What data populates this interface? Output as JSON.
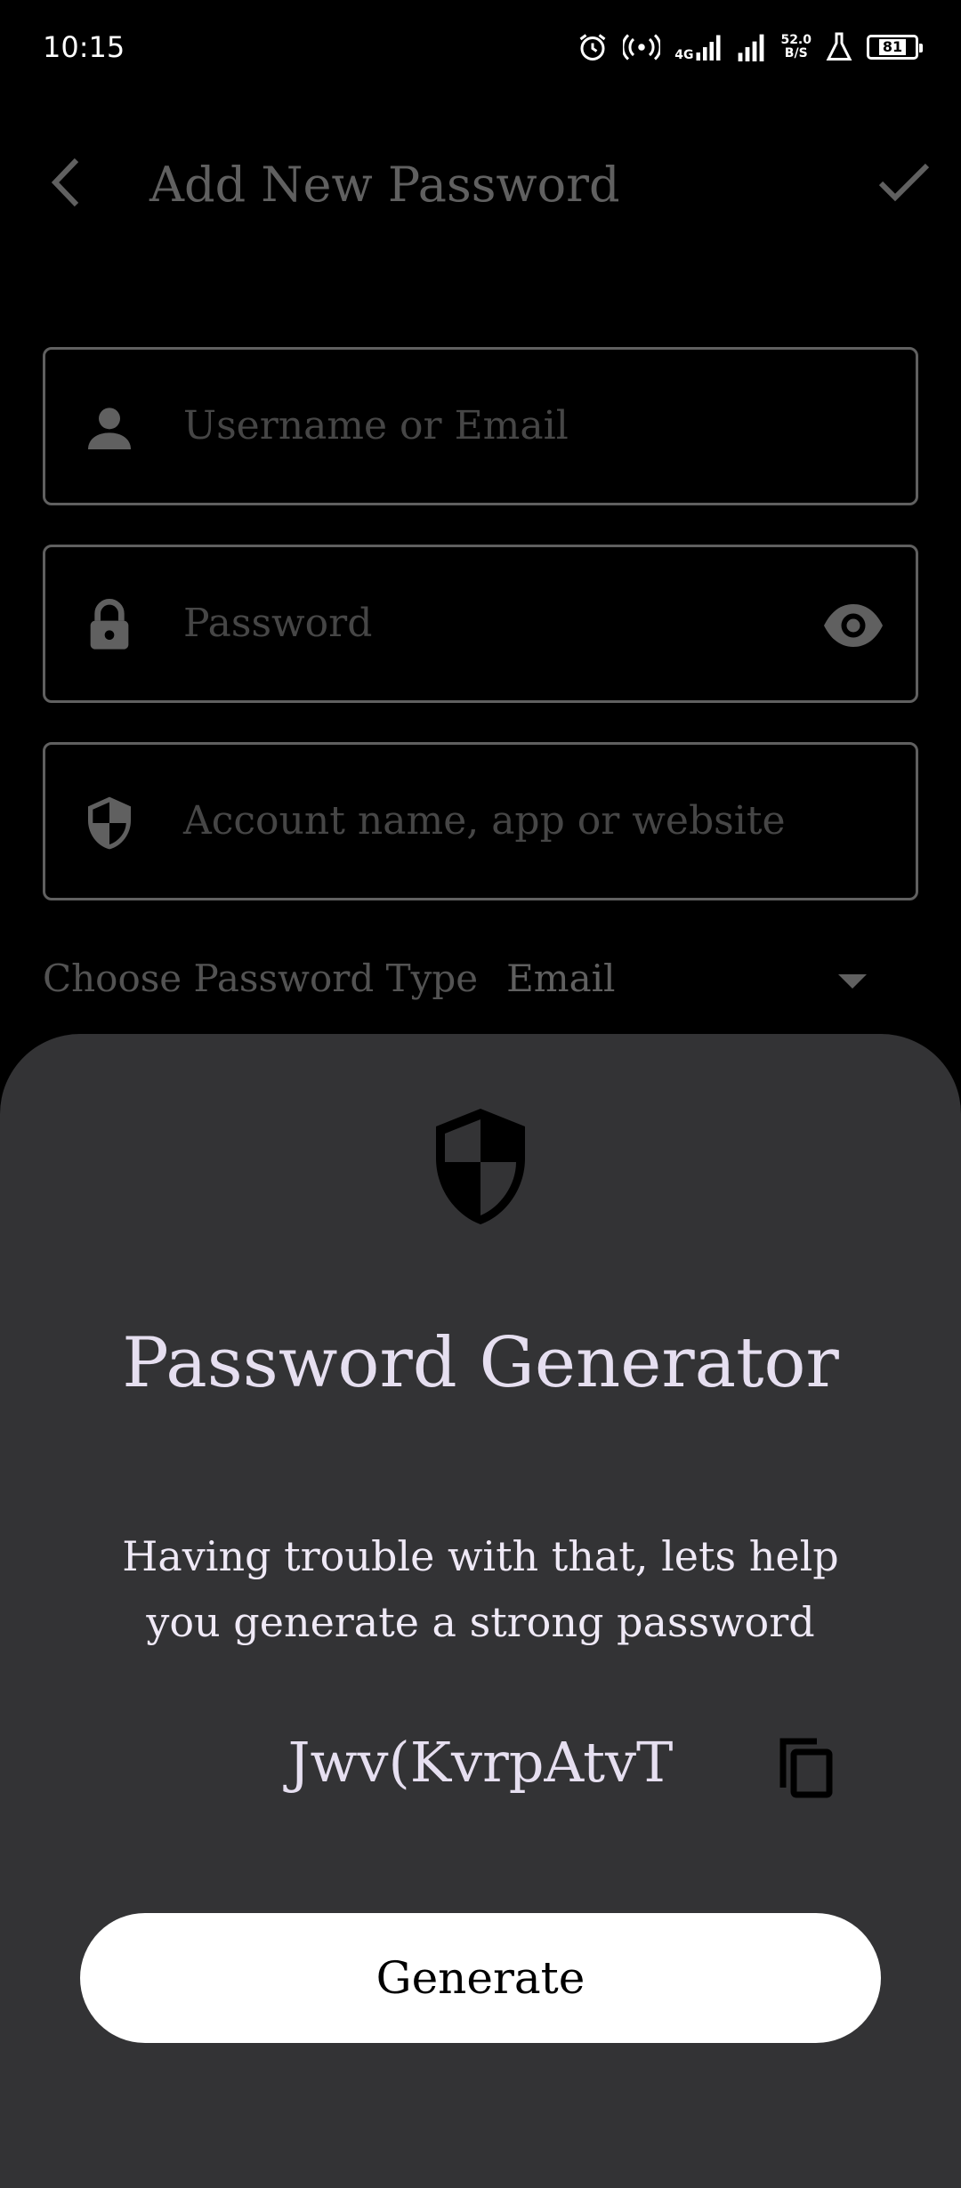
{
  "status": {
    "time": "10:15",
    "network": "4G",
    "speed_value": "52.0",
    "speed_unit": "B/S",
    "battery": "81"
  },
  "appbar": {
    "title": "Add New Password"
  },
  "fields": {
    "username_placeholder": "Username or Email",
    "password_placeholder": "Password",
    "account_placeholder": "Account name, app or website"
  },
  "password_type": {
    "label": "Choose Password Type",
    "value": "Email"
  },
  "sheet": {
    "title": "Password Generator",
    "description": "Having trouble with that, lets help you generate a strong password",
    "generated_password": "Jwv(KvrpAtvT",
    "generate_button": "Generate"
  },
  "icons": [
    "back-icon",
    "check-icon",
    "person-icon",
    "lock-icon",
    "eye-icon",
    "shield-icon",
    "dropdown-arrow-icon",
    "copy-icon",
    "alarm-icon",
    "hotspot-icon",
    "signal-icon",
    "battery-icon"
  ],
  "colors": {
    "sheet_bg": "#333335",
    "title_text": "#e6dff0",
    "button_bg": "#ffffff"
  }
}
